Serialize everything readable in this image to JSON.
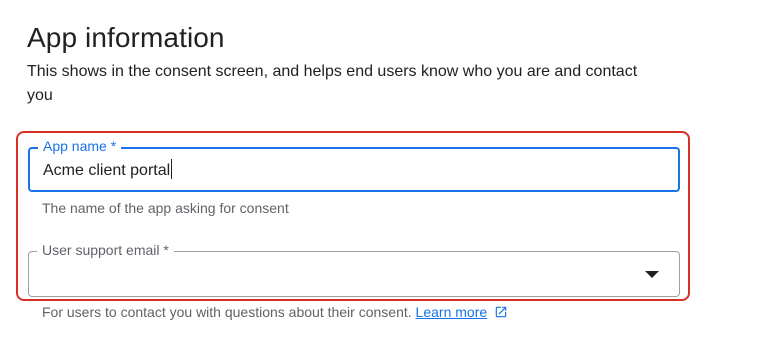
{
  "header": {
    "title": "App information",
    "description": "This shows in the consent screen, and helps end users know who you are and contact you"
  },
  "app_name_field": {
    "label": "App name *",
    "value": "Acme client portal",
    "hint": "The name of the app asking for consent"
  },
  "support_email_field": {
    "label": "User support email *",
    "selected_value": "",
    "hint": "For users to contact you with questions about their consent.",
    "link_label": "Learn more",
    "link_icon": "open-in-new-icon"
  },
  "colors": {
    "accent": "#1a73e8",
    "highlight": "#d93025"
  }
}
